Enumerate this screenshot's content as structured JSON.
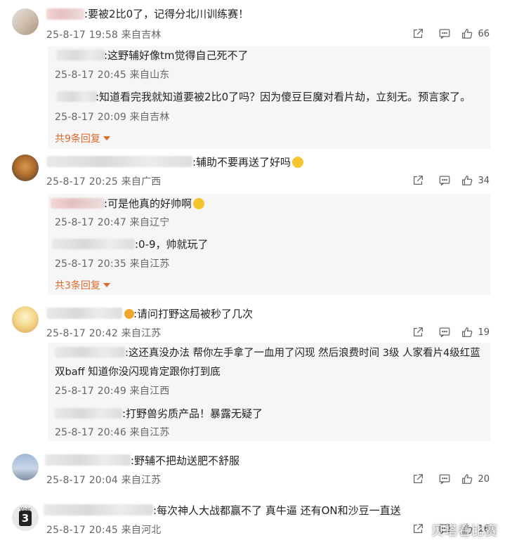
{
  "comments": [
    {
      "text": ":要被2比0了，记得分北川训练赛！",
      "meta": "25-8-17 19:58 来自吉林",
      "likes": "66",
      "replies": [
        {
          "text": ":这野辅好像tm觉得自己死不了",
          "meta": "25-8-17 20:45 来自山东"
        },
        {
          "text": ":知道看完我就知道要被2比0了吗？因为傻豆巨魔对看片劫，立刻无。预言家了。",
          "meta": "25-8-17 20:09 来自吉林"
        }
      ],
      "more_replies": "共9条回复"
    },
    {
      "text": ":辅助不要再送了好吗",
      "meta": "25-8-17 20:25 来自广西",
      "likes": "34",
      "replies": [
        {
          "text": ":可是他真的好帅啊",
          "meta": "25-8-17 20:47 来自辽宁"
        },
        {
          "text": ":0-9，帅就玩了",
          "meta": "25-8-17 20:35 来自江苏"
        }
      ],
      "more_replies": "共3条回复"
    },
    {
      "text": ":请问打野这局被秒了几次",
      "meta": "25-8-17 20:42 来自江苏",
      "likes": "19",
      "replies": [
        {
          "text_line1": ":这还真没办法 帮你左手拿了一血用了闪现 然后浪费时间 3级 人家看片4级红蓝",
          "text_line2": "双baff 知道你没闪现肯定跟你打到底",
          "meta": "25-8-17 20:49 来自江西"
        },
        {
          "text": ":打野兽劣质产品！暴露无疑了",
          "meta": "25-8-17 20:46 来自江苏"
        }
      ]
    },
    {
      "text": ":野辅不把劫送肥不舒服",
      "meta": "25-8-17 20:04 来自江苏",
      "likes": "20"
    },
    {
      "text": ":每次神人大战都赢不了 真牛逼 还有ON和沙豆一直送",
      "meta": "25-8-17 20:45 来自河北",
      "likes": "16",
      "avatar_badge_top": "Viper",
      "avatar_badge_num": "3"
    }
  ],
  "watermark": "贝塔看比赛",
  "colors": {
    "accent": "#e06a2b",
    "reply_bg": "#f6f6f6",
    "meta": "#666666"
  },
  "icons": [
    "share-icon",
    "comment-icon",
    "like-icon",
    "chevron-down-icon"
  ]
}
